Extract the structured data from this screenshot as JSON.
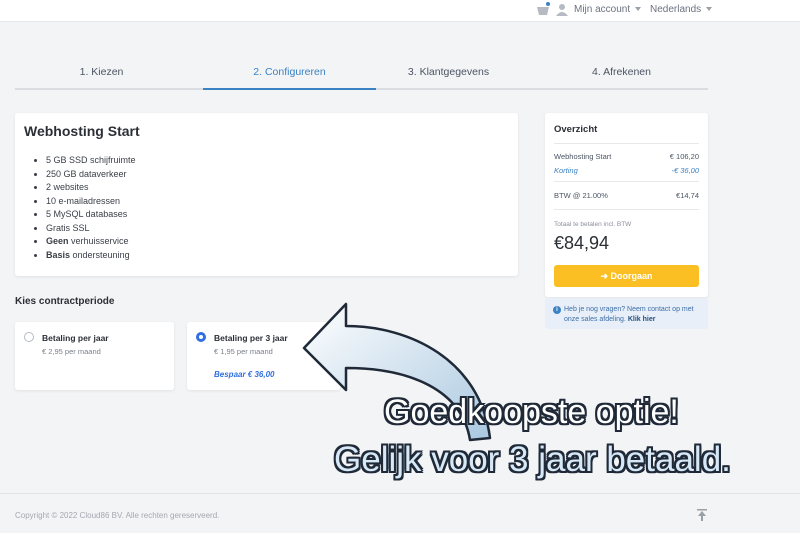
{
  "header": {
    "cart_icon": "basket-icon",
    "user_icon": "user-icon",
    "account_label": "Mijn account",
    "language_label": "Nederlands"
  },
  "steps": [
    {
      "label": "1. Kiezen",
      "active": false
    },
    {
      "label": "2. Configureren",
      "active": true
    },
    {
      "label": "3. Klantgegevens",
      "active": false
    },
    {
      "label": "4. Afrekenen",
      "active": false
    }
  ],
  "product": {
    "title": "Webhosting Start",
    "features": [
      {
        "bold": "",
        "text": "5 GB SSD schijfruimte"
      },
      {
        "bold": "",
        "text": "250 GB dataverkeer"
      },
      {
        "bold": "",
        "text": "2 websites"
      },
      {
        "bold": "",
        "text": "10 e-mailadressen"
      },
      {
        "bold": "",
        "text": "5 MySQL databases"
      },
      {
        "bold": "",
        "text": "Gratis SSL"
      },
      {
        "bold": "Geen",
        "text": " verhuisservice"
      },
      {
        "bold": "Basis",
        "text": " ondersteuning"
      }
    ]
  },
  "summary": {
    "title": "Overzicht",
    "rows": {
      "plan_label": "Webhosting Start",
      "plan_value": "€ 106,20",
      "discount_label": "Korting",
      "discount_value": "-€ 36,00",
      "vat_label": "BTW @ 21.00%",
      "vat_value": "€14,74"
    },
    "total_label": "Totaal te betalen incl. BTW",
    "total_value": "€84,94",
    "button_label": "Doorgaan",
    "button_color": "#fbbf24"
  },
  "help": {
    "text": "Heb je nog vragen? Neem contact op met onze sales afdeling.",
    "link": "Klik hier"
  },
  "period": {
    "title": "Kies contractperiode",
    "options": [
      {
        "name": "Betaling per jaar",
        "price": "€ 2,95 per maand",
        "selected": false,
        "save": ""
      },
      {
        "name": "Betaling per 3 jaar",
        "price": "€ 1,95 per maand",
        "selected": true,
        "save": "Bespaar € 36,00"
      }
    ]
  },
  "overlay": {
    "line1": "Goedkoopste optie!",
    "line2": "Gelijk voor 3 jaar betaald."
  },
  "footer": {
    "copyright": "Copyright © 2022 Cloud86 BV. Alle rechten gereserveerd.",
    "scroll_top_icon": "arrow-up-icon"
  },
  "colors": {
    "accent": "#3b82c4",
    "selected_radio": "#2f6fe0",
    "background": "#f3f4f6"
  }
}
